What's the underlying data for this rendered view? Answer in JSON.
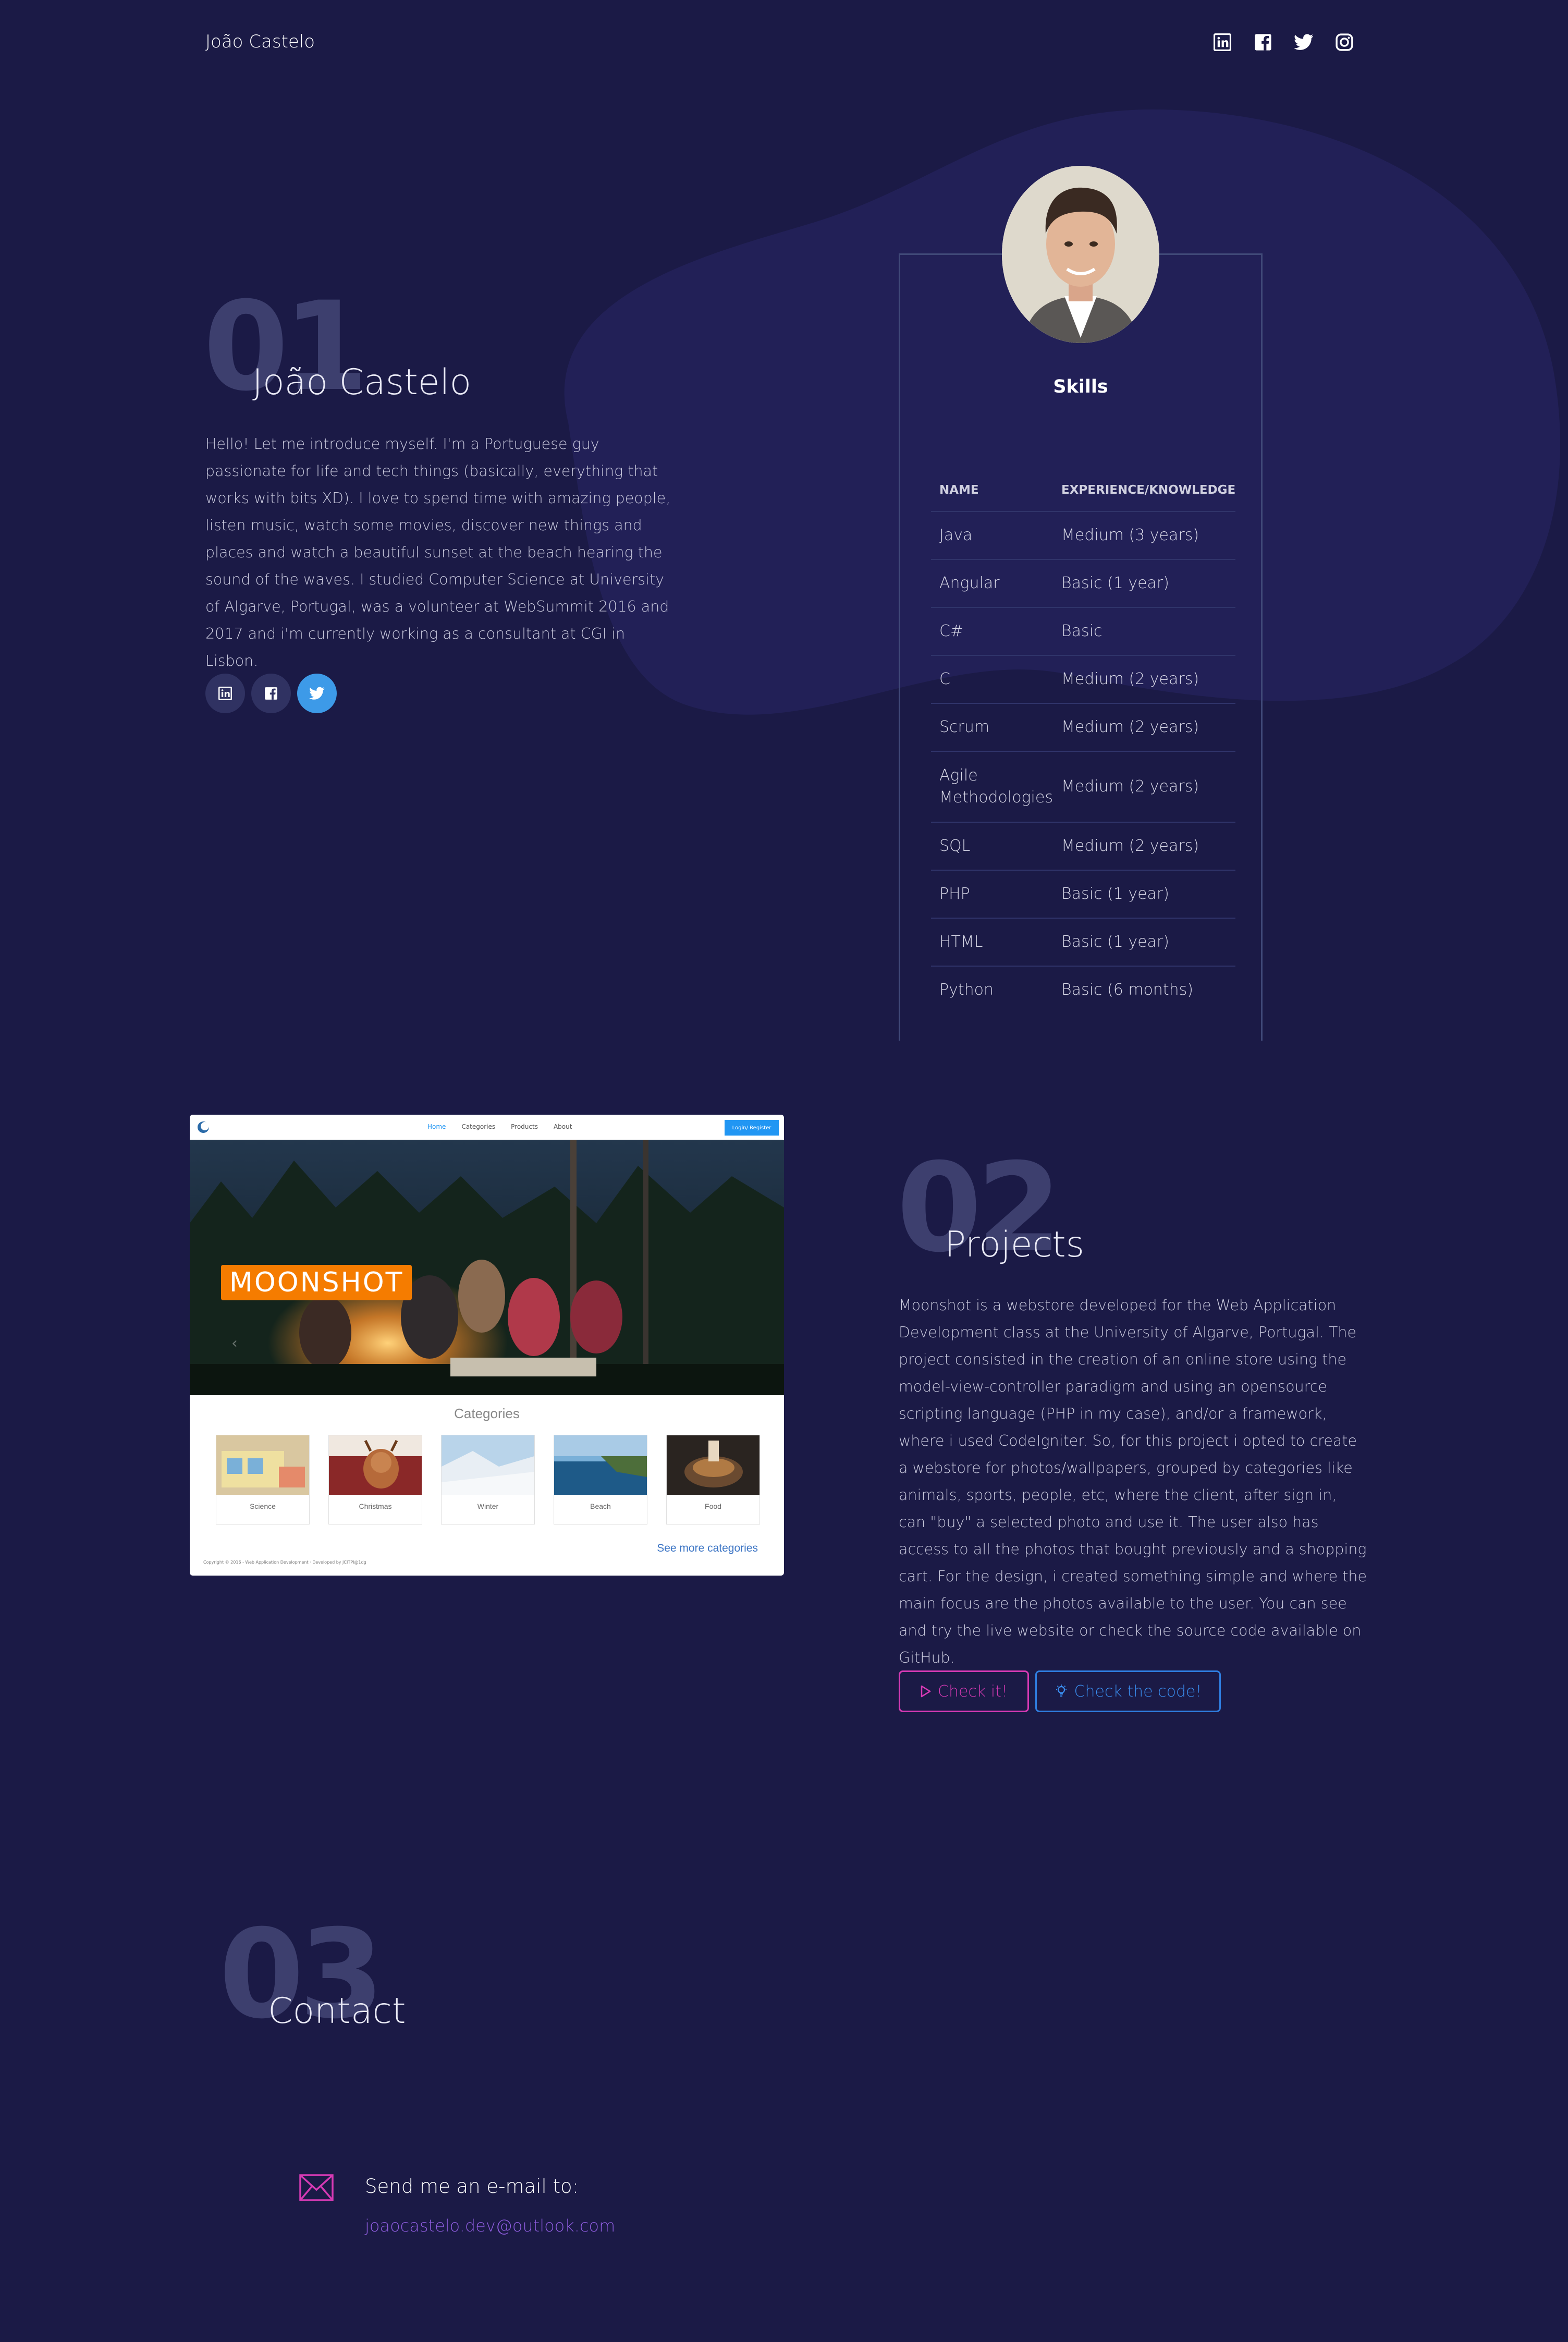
{
  "nav": {
    "brand": "João Castelo",
    "social_icons": [
      "linkedin-icon",
      "facebook-icon",
      "twitter-icon",
      "instagram-icon"
    ]
  },
  "about": {
    "number": "01",
    "title": "João Castelo",
    "bio": "Hello! Let me introduce myself. I'm a Portuguese guy passionate for life and tech things (basically, everything that works with bits XD). I love to spend time with amazing people, listen music, watch some movies, discover new things and places and watch a beautiful sunset at the beach hearing the sound of the waves. I studied Computer Science at University of Algarve, Portugal, was a volunteer at WebSummit 2016 and 2017 and i'm currently working as a consultant at CGI in Lisbon.",
    "social_icons": [
      "linkedin-icon",
      "facebook-icon",
      "twitter-icon"
    ]
  },
  "skills": {
    "title": "Skills",
    "headers": [
      "NAME",
      "EXPERIENCE/KNOWLEDGE"
    ],
    "rows": [
      [
        "Java",
        "Medium (3 years)"
      ],
      [
        "Angular",
        "Basic (1 year)"
      ],
      [
        "C#",
        "Basic"
      ],
      [
        "C",
        "Medium (2 years)"
      ],
      [
        "Scrum",
        "Medium (2 years)"
      ],
      [
        "Agile Methodologies",
        "Medium (2 years)"
      ],
      [
        "SQL",
        "Medium (2 years)"
      ],
      [
        "PHP",
        "Basic (1 year)"
      ],
      [
        "HTML",
        "Basic (1 year)"
      ],
      [
        "Python",
        "Basic (6 months)"
      ]
    ]
  },
  "project_preview": {
    "nav_links": [
      "Home",
      "Categories",
      "Products",
      "About"
    ],
    "login_label": "Login/ Register",
    "hero_logo": "MOONSHOT",
    "categories_title": "Categories",
    "categories": [
      "Science",
      "Christmas",
      "Winter",
      "Beach",
      "Food"
    ],
    "see_more": "See more categories",
    "footer": "Copyright © 2016 - Web Application Development · Developed by JCITPI@1dg"
  },
  "projects": {
    "number": "02",
    "title": "Projects",
    "description": "Moonshot is a webstore developed for the Web Application Development class at the University of Algarve, Portugal. The project consisted in the creation of an online store using the model-view-controller paradigm and using an opensource scripting language (PHP in my case), and/or a framework, where i used CodeIgniter. So, for this project i opted to create a webstore for photos/wallpapers, grouped by categories like animals, sports, people, etc, where the client, after sign in, can \"buy\" a selected photo and use it. The user also has access to all the photos that bought previously and a shopping cart. For the design, i created something simple and where the main focus are the photos available to the user. You can see and try the live website or check the source code available on GitHub.",
    "check_it_label": "Check it!",
    "check_code_label": "Check the code!"
  },
  "contact": {
    "number": "03",
    "title": "Contact",
    "mail_label": "Send me an e-mail to:",
    "email": "joaocastelo.dev@outlook.com"
  },
  "colors": {
    "background": "#1b1a46",
    "pink_accent": "#d63ab4",
    "blue_accent": "#2f7ee0",
    "twitter_blue": "#3d9ae8",
    "email_purple": "#8f5de0"
  }
}
